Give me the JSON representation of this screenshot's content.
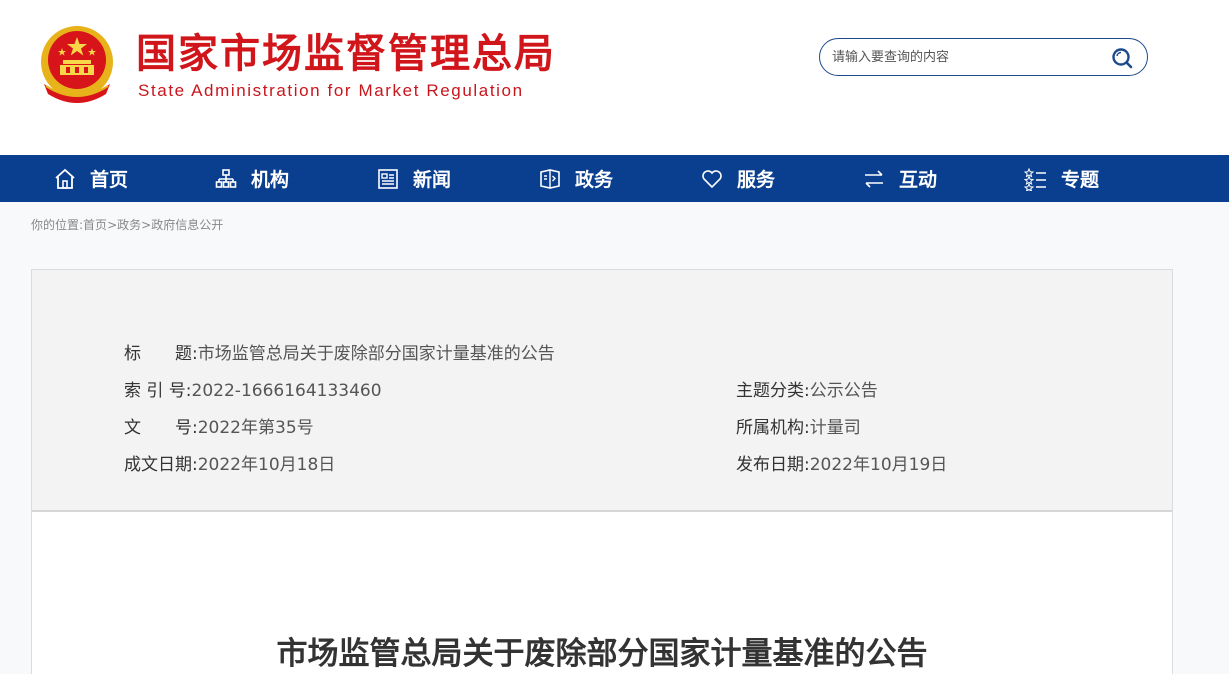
{
  "header": {
    "site_title": "国家市场监督管理总局",
    "site_subtitle": "State Administration for Market Regulation",
    "search": {
      "placeholder": "请输入要查询的内容",
      "value": ""
    },
    "colors": {
      "title_red": "#d0161b",
      "search_border": "#1d4a8a"
    }
  },
  "nav": {
    "background": "#0a3f8f",
    "items": [
      {
        "label": "首页",
        "icon": "home-icon"
      },
      {
        "label": "机构",
        "icon": "org-chart-icon"
      },
      {
        "label": "新闻",
        "icon": "news-icon"
      },
      {
        "label": "政务",
        "icon": "government-affairs-icon"
      },
      {
        "label": "服务",
        "icon": "heart-icon"
      },
      {
        "label": "互动",
        "icon": "exchange-arrows-icon"
      },
      {
        "label": "专题",
        "icon": "topic-list-icon"
      }
    ]
  },
  "breadcrumb": {
    "prefix": "你的位置:",
    "items": [
      "首页",
      "政务",
      "政府信息公开"
    ],
    "separator": ">"
  },
  "meta": {
    "title_label": "标　　题:",
    "title_value": "市场监管总局关于废除部分国家计量基准的公告",
    "index_label": "索 引 号:",
    "index_value": "2022-1666164133460",
    "category_label": "主题分类:",
    "category_value": "公示公告",
    "docno_label": "文　　号:",
    "docno_value": "2022年第35号",
    "org_label": "所属机构:",
    "org_value": "计量司",
    "created_label": "成文日期:",
    "created_value": "2022年10月18日",
    "published_label": "发布日期:",
    "published_value": "2022年10月19日"
  },
  "article": {
    "title": "市场监管总局关于废除部分国家计量基准的公告"
  }
}
